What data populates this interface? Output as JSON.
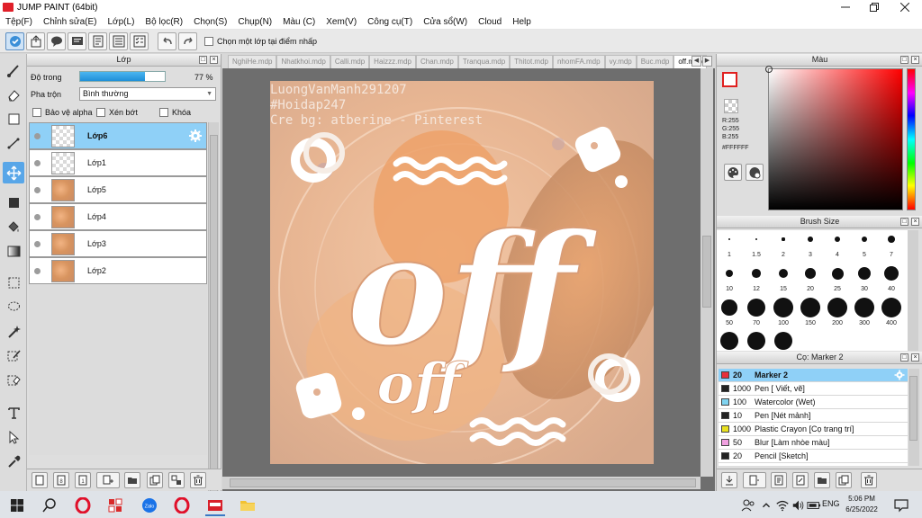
{
  "window": {
    "title": "JUMP PAINT (64bit)"
  },
  "menu": [
    "Tệp(F)",
    "Chỉnh sửa(E)",
    "Lớp(L)",
    "Bộ lọc(R)",
    "Chọn(S)",
    "Chụp(N)",
    "Màu (C)",
    "Xem(V)",
    "Công cụ(T)",
    "Cửa sổ(W)",
    "Cloud",
    "Help"
  ],
  "toolbar": {
    "select_option_label": "Chọn một lớp tại điểm nhấp"
  },
  "layer_panel": {
    "title": "Lớp",
    "opacity_label": "Độ trong",
    "opacity_value": "77 %",
    "opacity_fraction": 0.77,
    "blend_label": "Pha trộn",
    "blend_value": "Bình thường",
    "protect_alpha_label": "Bảo vệ alpha",
    "clip_label": "Xén bớt",
    "lock_label": "Khóa",
    "layers": [
      {
        "name": "Lớp6",
        "selected": true,
        "thumb": "empty"
      },
      {
        "name": "Lớp1",
        "selected": false,
        "thumb": "empty"
      },
      {
        "name": "Lớp5",
        "selected": false,
        "thumb": "photo"
      },
      {
        "name": "Lớp4",
        "selected": false,
        "thumb": "photo"
      },
      {
        "name": "Lớp3",
        "selected": false,
        "thumb": "photo"
      },
      {
        "name": "Lớp2",
        "selected": false,
        "thumb": "photo"
      }
    ]
  },
  "tabs": [
    "NghiHe.mdp",
    "Nhatkhoi.mdp",
    "Calli.mdp",
    "Haizzz.mdp",
    "Chan.mdp",
    "Tranqua.mdp",
    "Thitot.mdp",
    "nhomFA.mdp",
    "vy.mdp",
    "Buc.mdp",
    "off.mdp"
  ],
  "active_tab": "off.mdp",
  "artwork": {
    "credit_lines": [
      "LuongVanManh291207",
      "#Hoidap247",
      "Cre bg: atberine - Pinterest"
    ],
    "main_word": "off",
    "small_word": "off"
  },
  "color_panel": {
    "title": "Màu",
    "r": "R:255",
    "g": "G:255",
    "b": "B:255",
    "hex": "#FFFFFF",
    "fg_border_color": "#e0201f"
  },
  "brush_panel": {
    "title": "Brush Size",
    "sizes": [
      "1",
      "1.5",
      "2",
      "3",
      "4",
      "5",
      "7",
      "10",
      "12",
      "15",
      "20",
      "25",
      "30",
      "40",
      "50",
      "70",
      "100",
      "150",
      "200",
      "300",
      "400"
    ]
  },
  "tool_panel": {
    "title": "Cọ: Marker 2",
    "items": [
      {
        "size": "20",
        "name": "Marker 2",
        "color": "#e8303a",
        "selected": true
      },
      {
        "size": "1000",
        "name": "Pen [ Viết, vẽ]",
        "color": "#222222",
        "selected": false
      },
      {
        "size": "100",
        "name": "Watercolor (Wet)",
        "color": "#7fd3f0",
        "selected": false
      },
      {
        "size": "10",
        "name": "Pen [Nét mảnh]",
        "color": "#222222",
        "selected": false
      },
      {
        "size": "1000",
        "name": "Plastic Crayon [Cọ trang trí]",
        "color": "#e8e020",
        "selected": false
      },
      {
        "size": "50",
        "name": "Blur [Làm nhòe màu]",
        "color": "#f0a0e0",
        "selected": false
      },
      {
        "size": "20",
        "name": "Pencil [Sketch]",
        "color": "#222222",
        "selected": false
      }
    ]
  },
  "taskbar": {
    "language": "ENG",
    "time": "5:06 PM",
    "date": "6/25/2022"
  }
}
